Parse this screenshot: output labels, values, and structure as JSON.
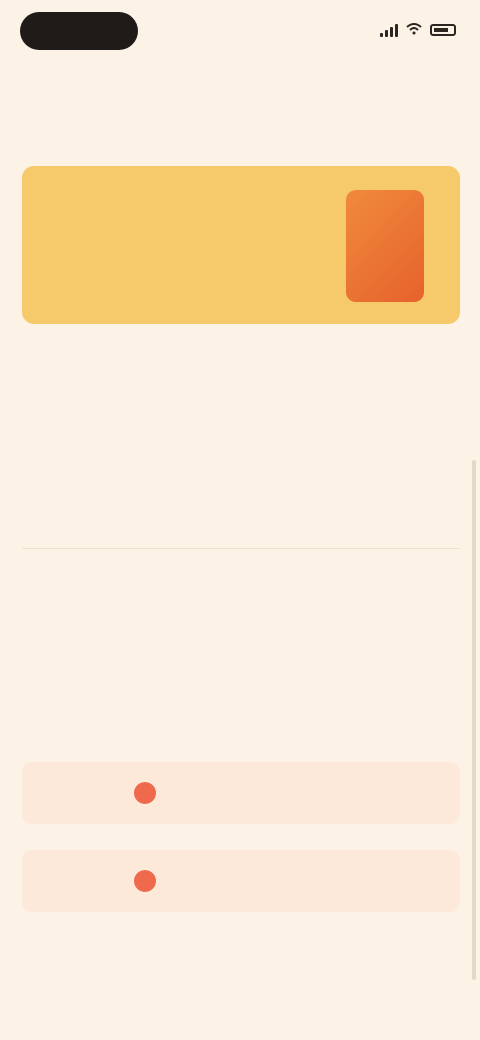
{
  "status_bar": {
    "time_pill": "",
    "icons": [
      "signal-icon",
      "wifi-icon",
      "battery-icon"
    ]
  },
  "header": {
    "back_label": ""
  },
  "banner": {
    "title": "",
    "subtitle": ""
  },
  "menu": {
    "items": [
      "",
      "",
      ""
    ],
    "secondary_items": [
      "",
      ""
    ],
    "danger_item": ""
  },
  "actions": [
    {
      "label": "",
      "icon": "alert-icon"
    },
    {
      "label": "",
      "icon": "alert-icon"
    }
  ],
  "footer": {
    "text": ""
  },
  "colors": {
    "background": "#fcf2e6",
    "banner": "#f6ca6a",
    "accent": "#ef6a4d",
    "danger": "#e77b7b",
    "action_bg": "#fde9da"
  }
}
